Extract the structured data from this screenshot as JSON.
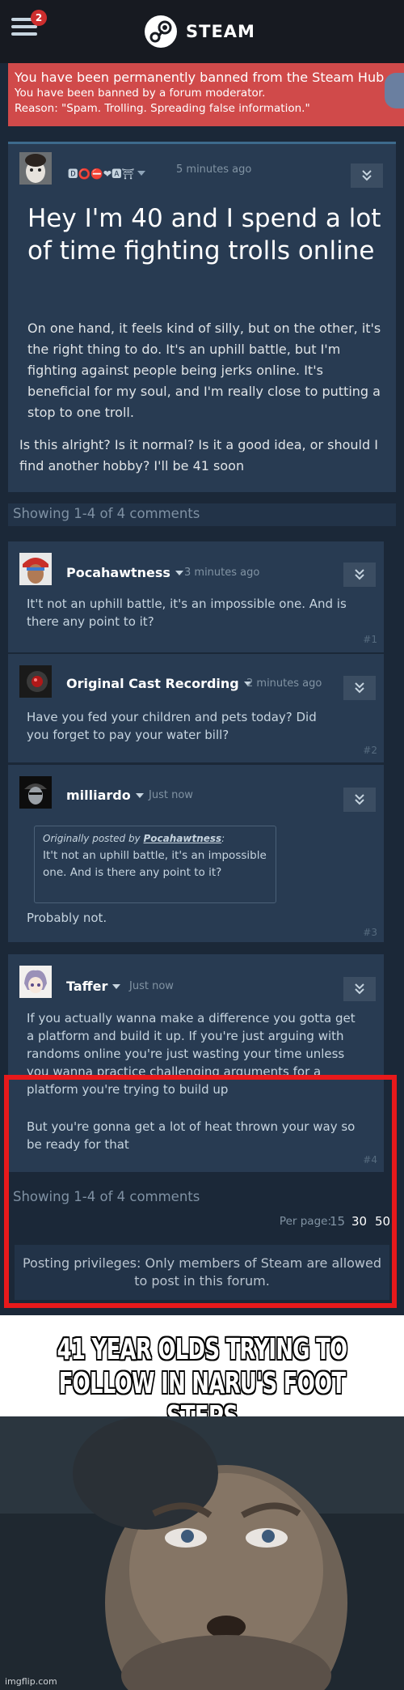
{
  "header": {
    "notification_count": "2",
    "logo_text": "STEAM"
  },
  "ban_notice": {
    "line1": "You have been permanently banned from the Steam Hub.",
    "line2": "You have been banned by a forum moderator.",
    "line3": "Reason: \"Spam. Trolling. Spreading false information.\""
  },
  "post": {
    "author": "🅳⭕⛔❤🅰⛩",
    "timestamp": "5 minutes ago",
    "title": "Hey I'm 40 and I spend a lot of time fighting trolls online",
    "body": "On one hand, it feels kind of silly, but on the other, it's the right thing to do. It's an uphill battle, but I'm fighting against people being jerks online. It's beneficial for my soul, and I'm really close to putting a stop to one troll.",
    "question": "Is this alright? Is it normal? Is it a good idea, or should I find another hobby? I'll be 41 soon"
  },
  "showing_top": "Showing 1-4 of 4 comments",
  "comments": [
    {
      "author": "Pocahawtness",
      "timestamp": "3 minutes ago",
      "text": "It't not an uphill battle, it's an impossible one. And is there any point to it?",
      "number": "#1"
    },
    {
      "author": "Original Cast Recording",
      "timestamp": "2 minutes ago",
      "text": "Have you fed your children and pets today? Did you forget to pay your water bill?",
      "number": "#2"
    },
    {
      "author": "milliardo",
      "timestamp": "Just now",
      "quote_prefix": "Originally posted by",
      "quote_author": "Pocahawtness",
      "quote_text": "It't not an uphill battle, it's an impossible one. And is there any point to it?",
      "text": "Probably not.",
      "number": "#3"
    },
    {
      "author": "Taffer",
      "timestamp": "Just now",
      "text": "If you actually wanna make a difference you gotta get a platform and build it up. If you're just arguing with randoms online you're just wasting your time unless you wanna practice challenging arguments for a platform you're trying to build up",
      "text2": "But you're gonna get a lot of heat thrown your way so be ready for that",
      "number": "#4"
    }
  ],
  "showing_bottom": "Showing 1-4 of 4 comments",
  "pager": {
    "label": "Per page:",
    "options": [
      "15",
      "30",
      "50"
    ]
  },
  "posting_privileges": "Posting privileges: Only members of Steam are allowed to post in this forum.",
  "meme_caption": {
    "line1": "41 YEAR OLDS TRYING TO",
    "line2": "FOLLOW IN NARU'S FOOT STEPS"
  },
  "watermark": "imgflip.com",
  "colors": {
    "ban_red": "#d04a4a",
    "highlight_red": "#e8191b",
    "panel": "#283b52",
    "background": "#1b2838"
  }
}
